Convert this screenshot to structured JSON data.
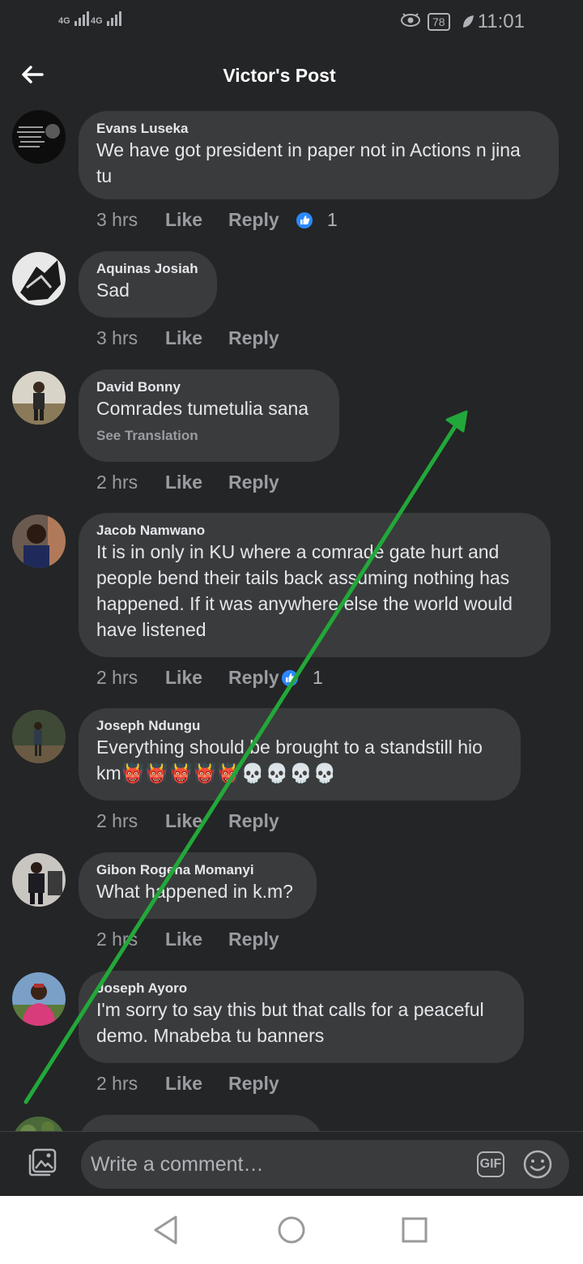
{
  "status_bar": {
    "signal_1": "4G",
    "signal_2": "4G",
    "battery": "78",
    "time": "11:01"
  },
  "header": {
    "title": "Victor's Post"
  },
  "actions": {
    "like": "Like",
    "reply": "Reply"
  },
  "comments": [
    {
      "author": "Evans Luseka",
      "text": "We have got president in paper not in Actions n jina tu",
      "time": "3 hrs",
      "reactions": "1"
    },
    {
      "author": "Aquinas Josiah",
      "text": "Sad",
      "time": "3 hrs"
    },
    {
      "author": "David Bonny",
      "text": "Comrades tumetulia sana",
      "translation_link": "See Translation",
      "time": "2 hrs"
    },
    {
      "author": "Jacob Namwano",
      "text": "It is in only in KU where a comrade gate hurt and people bend their tails back assuming nothing has happened. If it was anywhere else the world would have listened",
      "time": "2 hrs",
      "reactions": "1"
    },
    {
      "author": "Joseph Ndungu",
      "text": "Everything should be brought to a standstill hio km",
      "emojis": "👹👹👹👹👹💀💀💀💀",
      "time": "2 hrs"
    },
    {
      "author": "Gibon Rogena Momanyi",
      "text": "What happened in k.m?",
      "time": "2 hrs"
    },
    {
      "author": "Joseph Ayoro",
      "text": "I'm sorry to say this but that calls for a peaceful demo. Mnabeba tu banners",
      "time": "2 hrs"
    }
  ],
  "composer": {
    "placeholder": "Write a comment…",
    "gif_label": "GIF"
  },
  "icons": {
    "back": "arrow-left-icon",
    "photo": "photo-icon",
    "emoji": "smiley-icon",
    "like_reaction": "thumbs-up-icon",
    "nav_back": "triangle-back-icon",
    "nav_home": "circle-home-icon",
    "nav_recent": "square-recent-icon"
  },
  "colors": {
    "background": "#242526",
    "bubble": "#3a3b3c",
    "like_blue": "#2d88ff",
    "annotation_arrow": "#22a83a"
  }
}
